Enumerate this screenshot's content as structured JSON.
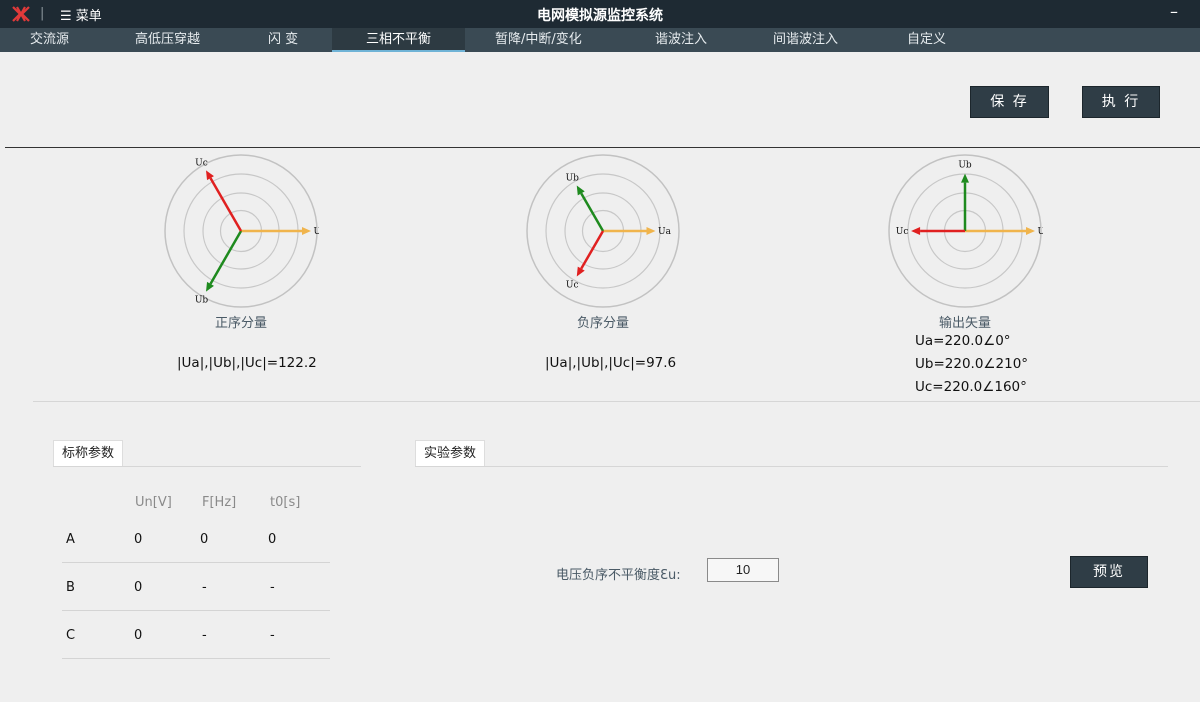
{
  "titlebar": {
    "menu_label": "☰ 菜单",
    "title": "电网模拟源监控系统",
    "minimize": "–"
  },
  "tabs": [
    {
      "label": "交流源"
    },
    {
      "label": "高低压穿越"
    },
    {
      "label": "闪 变"
    },
    {
      "label": "三相不平衡"
    },
    {
      "label": "暂降/中断/变化"
    },
    {
      "label": "谐波注入"
    },
    {
      "label": "间谐波注入"
    },
    {
      "label": "自定义"
    }
  ],
  "active_tab": "三相不平衡",
  "toolbar": {
    "save_label": "保 存",
    "execute_label": "执 行"
  },
  "vectors": {
    "positive": {
      "title": "正序分量",
      "value": "|Ua|,|Ub|,|Uc|=122.2",
      "labels": {
        "ua": "Ua",
        "ub": "Ub",
        "uc": "Uc"
      },
      "angles_deg": {
        "ua": 0,
        "ub": 240,
        "uc": 120
      }
    },
    "negative": {
      "title": "负序分量",
      "value": "|Ua|,|Ub|,|Uc|=97.6",
      "labels": {
        "ua": "Ua",
        "ub": "Ub",
        "uc": "Uc"
      },
      "angles_deg": {
        "ua": 0,
        "ub": 120,
        "uc": 240
      }
    },
    "output": {
      "title": "输出矢量",
      "labels": {
        "ua": "Ua",
        "ub": "Ub",
        "uc": "Uc"
      },
      "lines": [
        "Ua=220.0∠0°",
        "Ub=220.0∠210°",
        "Uc=220.0∠160°"
      ]
    }
  },
  "colors": {
    "ua": "#f0b44c",
    "ub": "#1e8a1e",
    "uc": "#e02020"
  },
  "nominal": {
    "tab_label": "标称参数",
    "headers": [
      "Un[V]",
      "F[Hz]",
      "t0[s]"
    ],
    "rows": [
      {
        "phase": "A",
        "un": "0",
        "f": "0",
        "t0": "0"
      },
      {
        "phase": "B",
        "un": "0",
        "f": "-",
        "t0": "-"
      },
      {
        "phase": "C",
        "un": "0",
        "f": "-",
        "t0": "-"
      }
    ]
  },
  "experiment": {
    "tab_label": "实验参数",
    "unbalance_label": "电压负序不平衡度Ɛu:",
    "unbalance_value": "10",
    "preview_label": "预览"
  }
}
